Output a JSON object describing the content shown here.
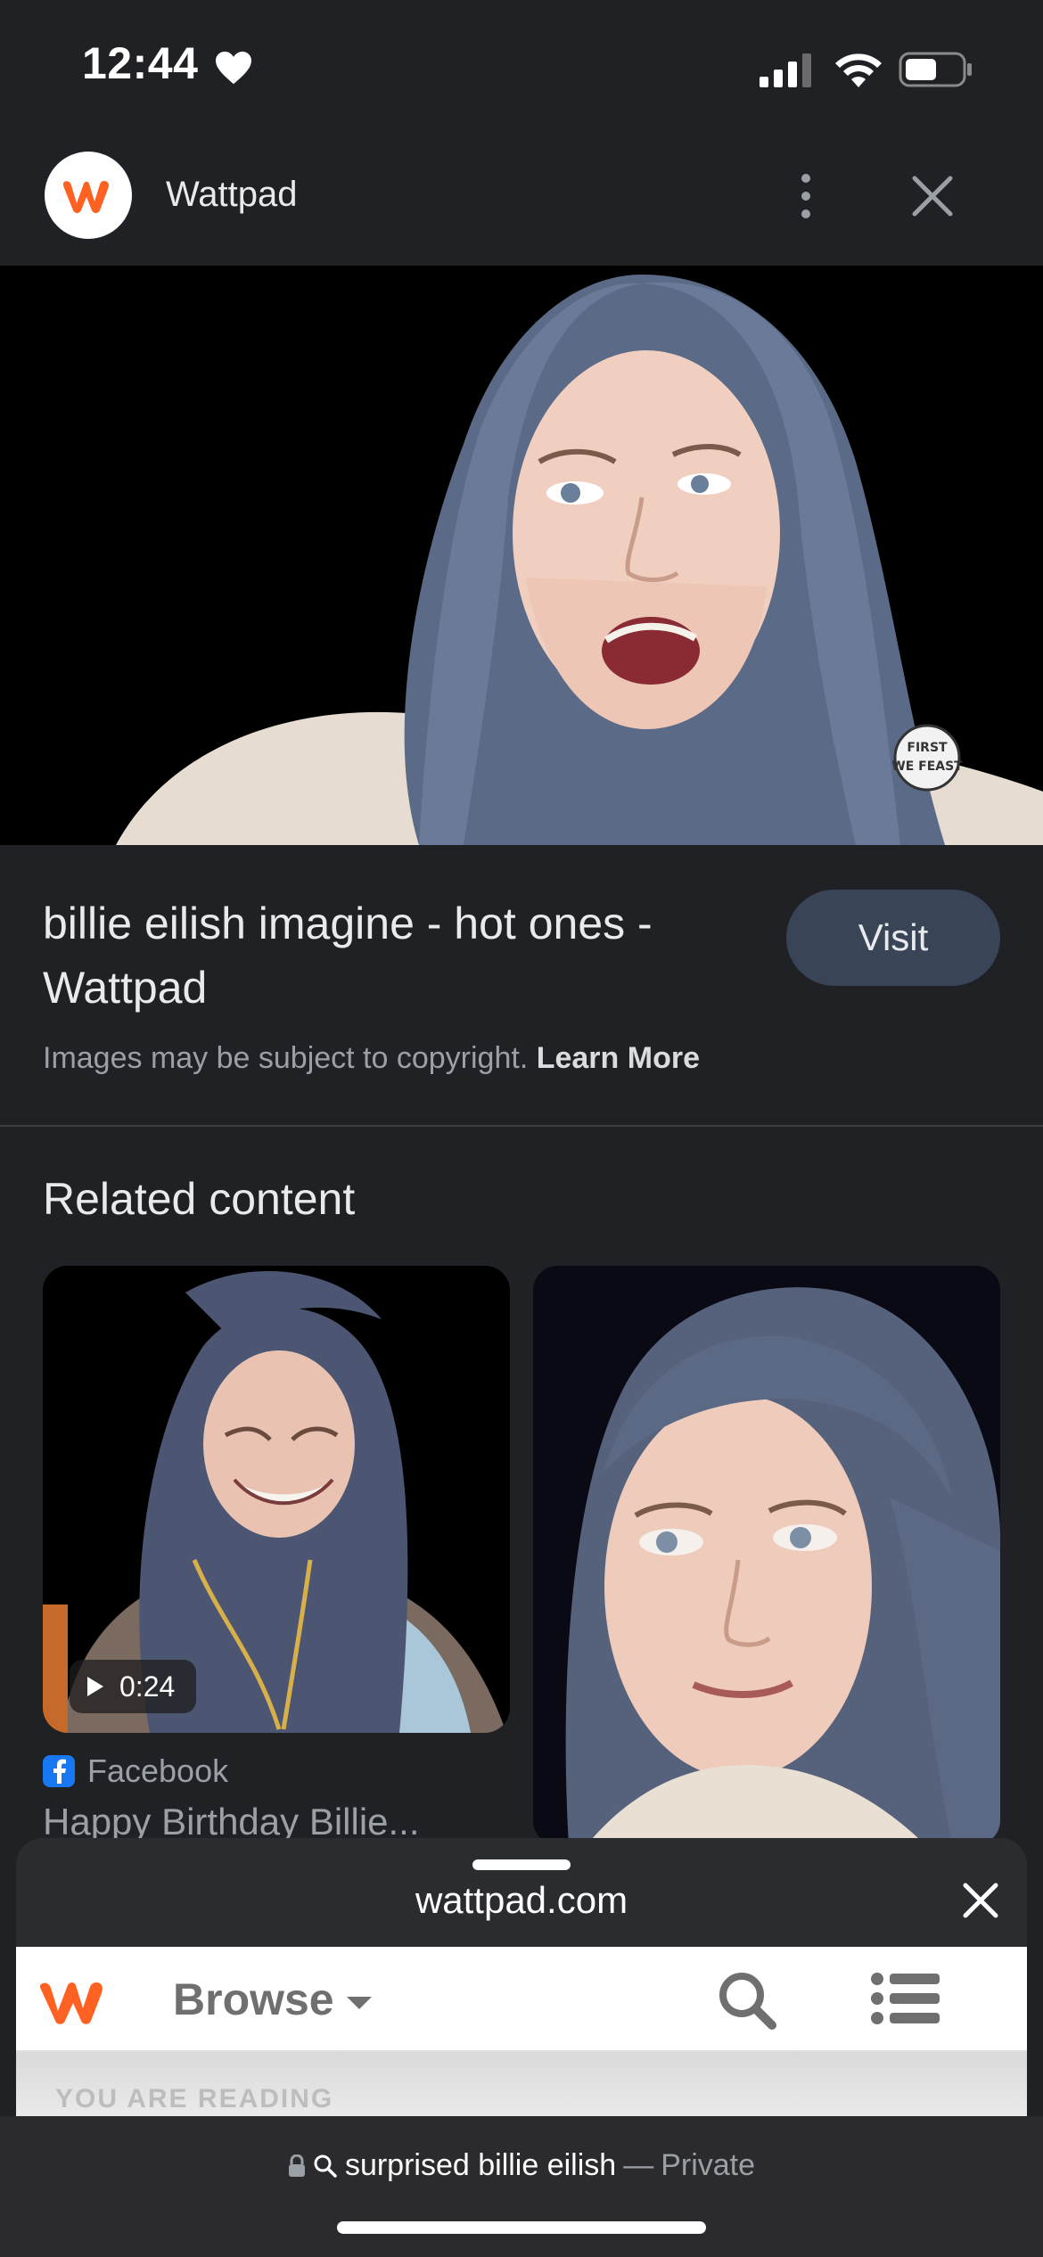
{
  "status_bar": {
    "time": "12:44",
    "icons": [
      "heart-icon",
      "signal-icon",
      "wifi-icon",
      "battery-icon"
    ]
  },
  "header": {
    "site_name": "Wattpad",
    "logo_letter": "w",
    "accent_color": "#ff6122"
  },
  "result": {
    "title": "billie eilish imagine - hot ones - Wattpad",
    "visit_label": "Visit",
    "copyright_text": "Images may be subject to copyright.",
    "learn_more": "Learn More"
  },
  "related": {
    "heading": "Related content",
    "cards": [
      {
        "duration": "0:24",
        "source": "Facebook",
        "title": "Happy Birthday Billie..."
      },
      {
        "duration": "",
        "source": "",
        "title": ""
      }
    ]
  },
  "sheet": {
    "url": "wattpad.com",
    "browse_label": "Browse",
    "reading_label": "YOU ARE READING"
  },
  "bottom_bar": {
    "query": "surprised billie eilish",
    "separator": "—",
    "mode": "Private"
  }
}
